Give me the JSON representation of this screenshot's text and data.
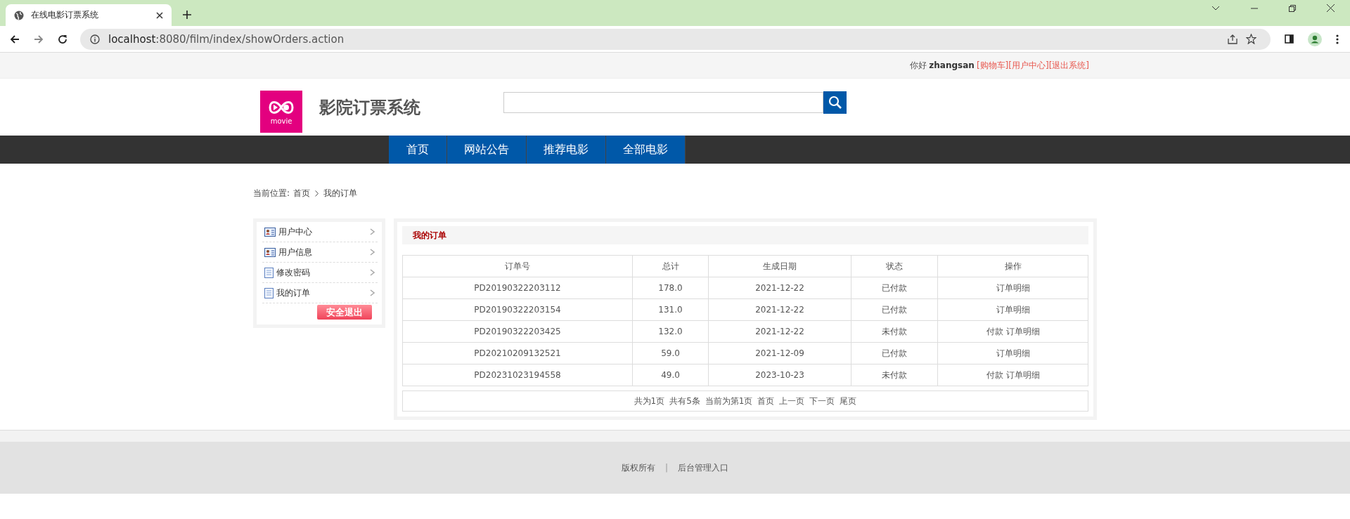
{
  "browser": {
    "tab_title": "在线电影订票系统",
    "url_host": "localhost",
    "url_rest": ":8080/film/index/showOrders.action"
  },
  "top_bar": {
    "greeting": "你好",
    "username": "zhangsan",
    "links": [
      "[购物车]",
      "[用户中心]",
      "[退出系统]"
    ]
  },
  "header": {
    "logo_text": "movie",
    "site_title": "影院订票系统"
  },
  "nav": [
    "首页",
    "网站公告",
    "推荐电影",
    "全部电影"
  ],
  "breadcrumb": {
    "label": "当前位置:",
    "items": [
      "首页",
      "我的订单"
    ]
  },
  "sidebar": {
    "items": [
      {
        "label": "用户中心",
        "kind": "card"
      },
      {
        "label": "用户信息",
        "kind": "card"
      },
      {
        "label": "修改密码",
        "kind": "document"
      },
      {
        "label": "我的订单",
        "kind": "document"
      }
    ],
    "logout": "安全退出"
  },
  "orders": {
    "title": "我的订单",
    "columns": [
      "订单号",
      "总计",
      "生成日期",
      "状态",
      "操作"
    ],
    "rows": [
      {
        "order_no": "PD20190322203112",
        "total": "178.0",
        "date": "2021-12-22",
        "status": "已付款",
        "actions": [
          "订单明细"
        ]
      },
      {
        "order_no": "PD20190322203154",
        "total": "131.0",
        "date": "2021-12-22",
        "status": "已付款",
        "actions": [
          "订单明细"
        ]
      },
      {
        "order_no": "PD20190322203425",
        "total": "132.0",
        "date": "2021-12-22",
        "status": "未付款",
        "actions": [
          "付款",
          "订单明细"
        ]
      },
      {
        "order_no": "PD20210209132521",
        "total": "59.0",
        "date": "2021-12-09",
        "status": "已付款",
        "actions": [
          "订单明细"
        ]
      },
      {
        "order_no": "PD20231023194558",
        "total": "49.0",
        "date": "2023-10-23",
        "status": "未付款",
        "actions": [
          "付款",
          "订单明细"
        ]
      }
    ],
    "pagination": [
      "共为1页",
      "共有5条",
      "当前为第1页",
      "首页",
      "上一页",
      "下一页",
      "尾页"
    ]
  },
  "footer": {
    "links": [
      "版权所有",
      "后台管理入口"
    ],
    "separator": "|"
  }
}
